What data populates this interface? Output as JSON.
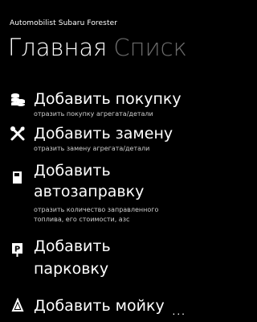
{
  "app": {
    "title": "Automobilist Subaru Forester"
  },
  "pivot": {
    "active": "Главная",
    "inactive": "Списк"
  },
  "items": [
    {
      "icon": "coins-icon",
      "title": "Добавить покупку",
      "subtitle": "отразить покупку агрегата/детали"
    },
    {
      "icon": "wrench-screwdriver-icon",
      "title": "Добавить замену",
      "subtitle": "отразить замену агрегата/детали"
    },
    {
      "icon": "fuel-pump-icon",
      "title_line1": "Добавить",
      "title_line2": "автозаправку",
      "subtitle_line1": "отразить количество заправленного",
      "subtitle_line2": "топлива, его стоимости, азс"
    },
    {
      "icon": "parking-icon",
      "title_line1": "Добавить",
      "title_line2": "парковку"
    },
    {
      "icon": "car-wash-icon",
      "title": "Добавить мойку"
    }
  ],
  "appbar": {
    "more": "..."
  }
}
